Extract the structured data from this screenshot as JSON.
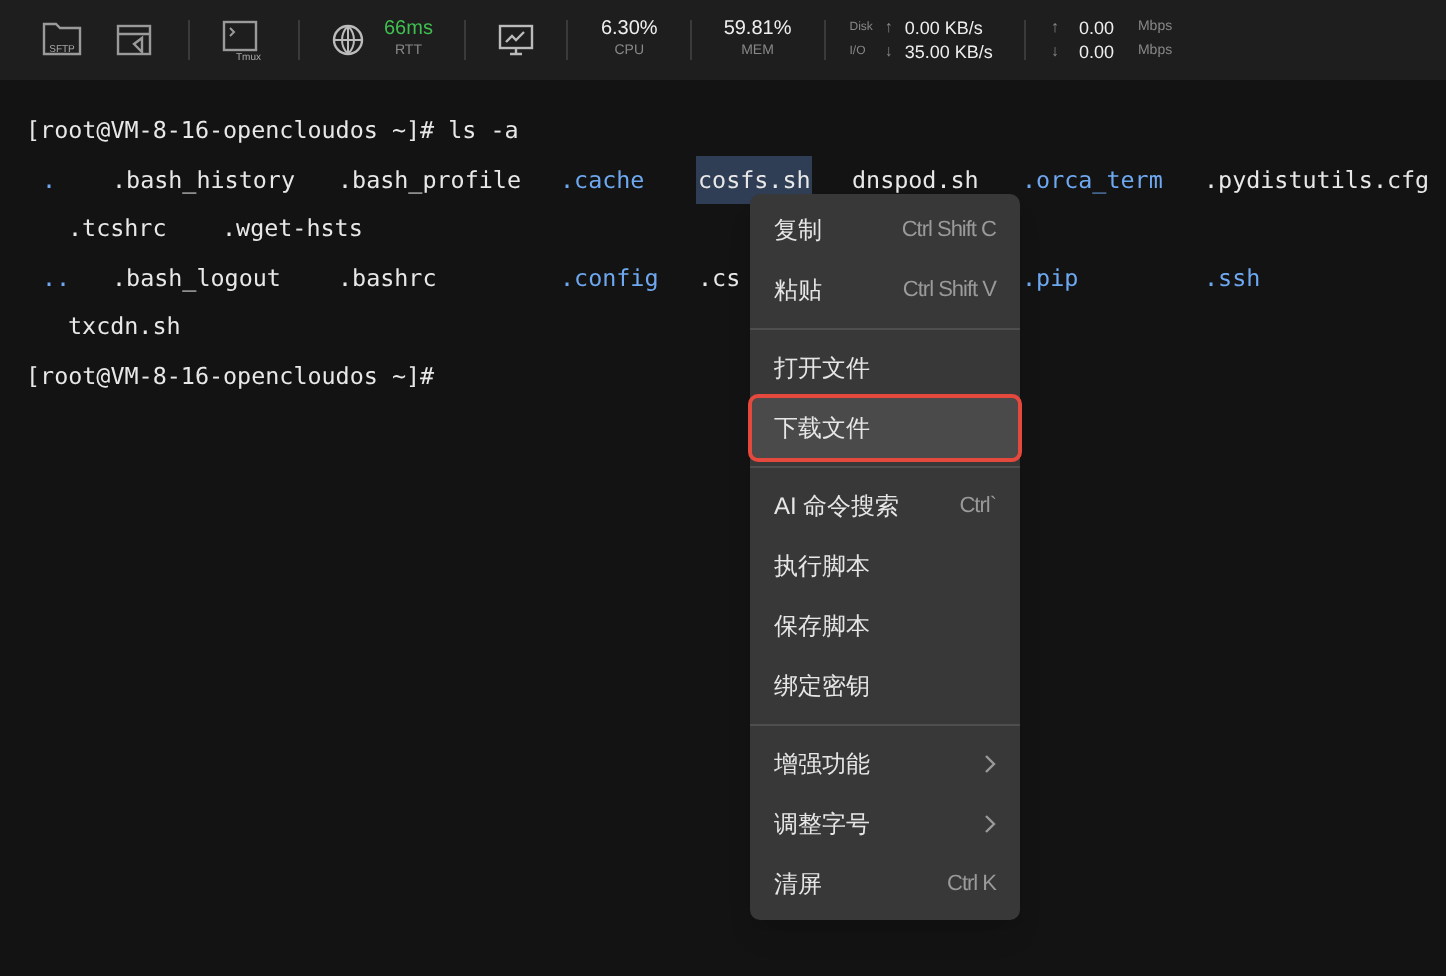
{
  "toolbar": {
    "buttons": [
      {
        "kind": "sftp",
        "label": "SFTP"
      },
      {
        "kind": "window"
      },
      {
        "kind": "tmux",
        "label": "Tmux"
      }
    ],
    "rtt": {
      "value": "66ms",
      "label": "RTT"
    },
    "cpu": {
      "value": "6.30%",
      "label": "CPU"
    },
    "mem": {
      "value": "59.81%",
      "label": "MEM"
    },
    "disk": {
      "label_top": "Disk",
      "label_bottom": "I/O",
      "arrow_up": "↑",
      "arrow_down": "↓",
      "up": "0.00 KB/s",
      "down": "35.00 KB/s"
    },
    "network": {
      "arrow_up": "↑",
      "arrow_down": "↓",
      "up": "0.00",
      "down": "0.00",
      "unit_up": "Mbps",
      "unit_down": "Mbps"
    }
  },
  "terminal": {
    "lines": [
      {
        "kind": "prompt",
        "text": "[root@VM-8-16-opencloudos ~]# ls -a"
      },
      {
        "kind": "columns",
        "items": [
          {
            "text": ".",
            "kind": "directory",
            "selected": false
          },
          {
            "text": ".bash_history",
            "kind": "file",
            "selected": false
          },
          {
            "text": ".bash_profile",
            "kind": "file",
            "selected": false
          },
          {
            "text": ".cache",
            "kind": "directory",
            "selected": false
          },
          {
            "text": "cosfs.sh",
            "kind": "file",
            "selected": true
          },
          {
            "text": "dnspod.sh",
            "kind": "file",
            "selected": false
          },
          {
            "text": ".orca_term",
            "kind": "directory",
            "selected": false
          },
          {
            "text": ".pydistutils.cfg",
            "kind": "file",
            "selected": false
          }
        ]
      },
      {
        "kind": "wrap",
        "items": [
          {
            "text": ".tcshrc",
            "kind": "file",
            "selected": false
          },
          {
            "text": ".wget-hsts",
            "kind": "file",
            "selected": false
          }
        ]
      },
      {
        "kind": "columns_gap",
        "items": [
          {
            "text": "..",
            "kind": "directory",
            "selected": false
          },
          {
            "text": ".bash_logout",
            "kind": "file",
            "selected": false
          },
          {
            "text": ".bashrc",
            "kind": "file",
            "selected": false
          },
          {
            "text": ".config",
            "kind": "directory",
            "selected": false
          },
          {
            "text": ".cs",
            "kind": "file",
            "selected": false
          },
          {
            "text": ".pip",
            "kind": "directory",
            "selected": false
          },
          {
            "text": ".ssh",
            "kind": "directory",
            "selected": false
          }
        ]
      },
      {
        "kind": "wrap",
        "items": [
          {
            "text": "txcdn.sh",
            "kind": "file",
            "selected": false
          }
        ]
      },
      {
        "kind": "prompt",
        "text": "[root@VM-8-16-opencloudos ~]#"
      }
    ]
  },
  "context_menu": {
    "items": [
      {
        "kind": "item",
        "label": "复制",
        "shortcut": "Ctrl Shift C",
        "submenu": false,
        "selected": false
      },
      {
        "kind": "item",
        "label": "粘贴",
        "shortcut": "Ctrl Shift V",
        "submenu": false,
        "selected": false
      },
      {
        "kind": "separator"
      },
      {
        "kind": "item",
        "label": "打开文件",
        "submenu": false,
        "selected": false
      },
      {
        "kind": "item",
        "label": "下载文件",
        "submenu": false,
        "selected": true
      },
      {
        "kind": "separator"
      },
      {
        "kind": "item",
        "label": "AI 命令搜索",
        "shortcut": "Ctrl`",
        "submenu": false,
        "selected": false
      },
      {
        "kind": "item",
        "label": "执行脚本",
        "submenu": false,
        "selected": false
      },
      {
        "kind": "item",
        "label": "保存脚本",
        "submenu": false,
        "selected": false
      },
      {
        "kind": "item",
        "label": "绑定密钥",
        "submenu": false,
        "selected": false
      },
      {
        "kind": "separator"
      },
      {
        "kind": "item",
        "label": "增强功能",
        "submenu": true,
        "selected": false
      },
      {
        "kind": "item",
        "label": "调整字号",
        "submenu": true,
        "selected": false
      },
      {
        "kind": "item",
        "label": "清屏",
        "shortcut": "Ctrl K",
        "submenu": false,
        "selected": false
      }
    ]
  }
}
